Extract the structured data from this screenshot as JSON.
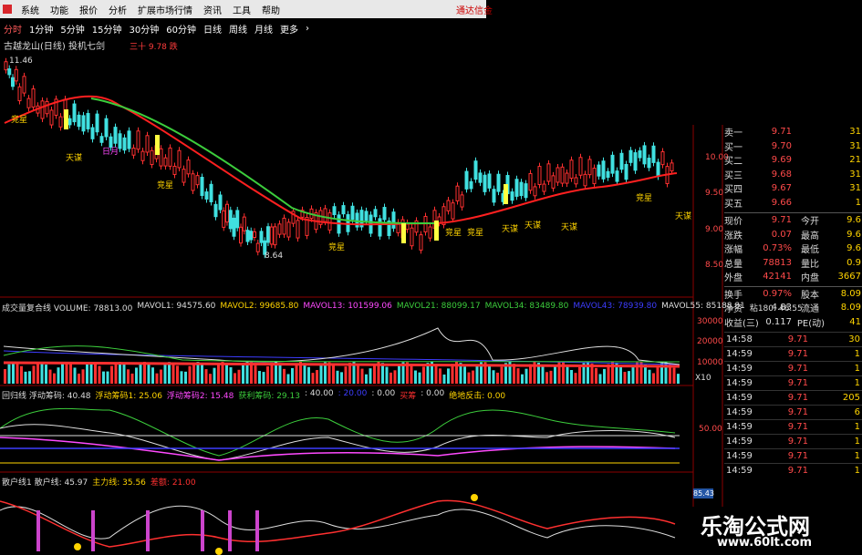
{
  "menu": {
    "items": [
      "系统",
      "功能",
      "报价",
      "分析",
      "扩展市场行情",
      "资讯",
      "工具",
      "帮助"
    ],
    "broker": "通达信金"
  },
  "periods": {
    "items": [
      "分时",
      "1分钟",
      "5分钟",
      "15分钟",
      "30分钟",
      "60分钟",
      "日线",
      "周线",
      "月线",
      "更多"
    ],
    "active_index": 0
  },
  "chart_title": {
    "text": "古越龙山(日线) 投机七剑",
    "signal": "三十 9.78 跌"
  },
  "price_chart": {
    "high_label": "11.46",
    "low_label": "8.64",
    "annotations": [
      "竞星",
      "天谋",
      "日月",
      "竞星",
      "竞星",
      "竞星",
      "天谋",
      "天谋",
      "天谋",
      "竞星",
      "天谋",
      "竞星"
    ],
    "y_axis": [
      "10.00",
      "9.50",
      "9.00",
      "8.50"
    ],
    "colors": {
      "up": "#ff3030",
      "down": "#40e0e0",
      "ma_fast": "#ff2020",
      "ma_slow": "#3ccd3c",
      "signal_yellow": "#ffff40"
    }
  },
  "volume_panel": {
    "legend": [
      {
        "text": "成交量复合线 VOLUME: 78813.00",
        "color": "#dddddd"
      },
      {
        "text": "MAVOL1: 94575.60",
        "color": "#dddddd"
      },
      {
        "text": "MAVOL2: 99685.80",
        "color": "#ffd400"
      },
      {
        "text": "MAVOL13: 101599.06",
        "color": "#ff4aff"
      },
      {
        "text": "MAVOL21: 88099.17",
        "color": "#3ccd3c"
      },
      {
        "text": "MAVOL34: 83489.80",
        "color": "#3ccd3c"
      },
      {
        "text": "MAVOL43: 78939.80",
        "color": "#3d3dff"
      },
      {
        "text": "MAVOL55: 85188.81",
        "color": "#dddddd"
      },
      {
        "text": "粘180: 46.55",
        "color": "#dddddd"
      }
    ],
    "y_axis": [
      "30000",
      "20000",
      "10000"
    ],
    "unit": "X10"
  },
  "indicator1": {
    "legend": [
      {
        "text": "回归线 浮动筹码: 40.48",
        "color": "#dddddd"
      },
      {
        "text": "浮动筹码1: 25.06",
        "color": "#ffd400"
      },
      {
        "text": "浮动筹码2: 15.48",
        "color": "#ff4aff"
      },
      {
        "text": "获利筹码: 29.13",
        "color": "#3ccd3c"
      },
      {
        "text": ": 40.00",
        "color": "#dddddd"
      },
      {
        "text": ": 20.00",
        "color": "#3d3dff"
      },
      {
        "text": ": 0.00",
        "color": "#dddddd"
      },
      {
        "text": "买筹",
        "color": "#ff3030"
      },
      {
        "text": ": 0.00",
        "color": "#dddddd"
      },
      {
        "text": "绝地反击: 0.00",
        "color": "#ffd400"
      }
    ],
    "y_axis": [
      "50.00"
    ]
  },
  "indicator2": {
    "legend": [
      {
        "text": "散户线1 散户线: 45.97",
        "color": "#dddddd"
      },
      {
        "text": "主力线: 35.56",
        "color": "#ffd400"
      },
      {
        "text": "差额: 21.00",
        "color": "#ff3030"
      }
    ],
    "badge": "85.43"
  },
  "quote": {
    "order_book": [
      {
        "label": "卖一",
        "price": "9.71",
        "vol": "31"
      },
      {
        "label": "买一",
        "price": "9.70",
        "vol": "31"
      },
      {
        "label": "买二",
        "price": "9.69",
        "vol": "21"
      },
      {
        "label": "买三",
        "price": "9.68",
        "vol": "31"
      },
      {
        "label": "买四",
        "price": "9.67",
        "vol": "31"
      },
      {
        "label": "买五",
        "price": "9.66",
        "vol": "1"
      }
    ],
    "stats": [
      {
        "k1": "现价",
        "v1": "9.71",
        "k2": "今开",
        "v2": "9.6"
      },
      {
        "k1": "涨跌",
        "v1": "0.07",
        "k2": "最高",
        "v2": "9.6"
      },
      {
        "k1": "涨幅",
        "v1": "0.73%",
        "k2": "最低",
        "v2": "9.6"
      },
      {
        "k1": "总量",
        "v1": "78813",
        "k2": "量比",
        "v2": "0.9"
      },
      {
        "k1": "外盘",
        "v1": "42141",
        "k2": "内盘",
        "v2": "3667"
      },
      {
        "k1": "换手",
        "v1": "0.97%",
        "k2": "股本",
        "v2": "8.09"
      },
      {
        "k1": "净资",
        "v1": "4.83",
        "k2": "流通",
        "v2": "8.09"
      },
      {
        "k1": "收益(三)",
        "v1": "0.117",
        "k2": "PE(动)",
        "v2": "41"
      }
    ],
    "ticks": [
      {
        "time": "14:58",
        "price": "9.71",
        "vol": "30"
      },
      {
        "time": "14:59",
        "price": "9.71",
        "vol": "1"
      },
      {
        "time": "14:59",
        "price": "9.71",
        "vol": "1"
      },
      {
        "time": "14:59",
        "price": "9.71",
        "vol": "1"
      },
      {
        "time": "14:59",
        "price": "9.71",
        "vol": "205"
      },
      {
        "time": "14:59",
        "price": "9.71",
        "vol": "6"
      },
      {
        "time": "14:59",
        "price": "9.71",
        "vol": "1"
      },
      {
        "time": "14:59",
        "price": "9.71",
        "vol": "1"
      },
      {
        "time": "14:59",
        "price": "9.71",
        "vol": "1"
      },
      {
        "time": "14:59",
        "price": "9.71",
        "vol": "1"
      }
    ]
  },
  "watermark": {
    "cn": "乐淘公式网",
    "url": "www.60lt.com"
  }
}
